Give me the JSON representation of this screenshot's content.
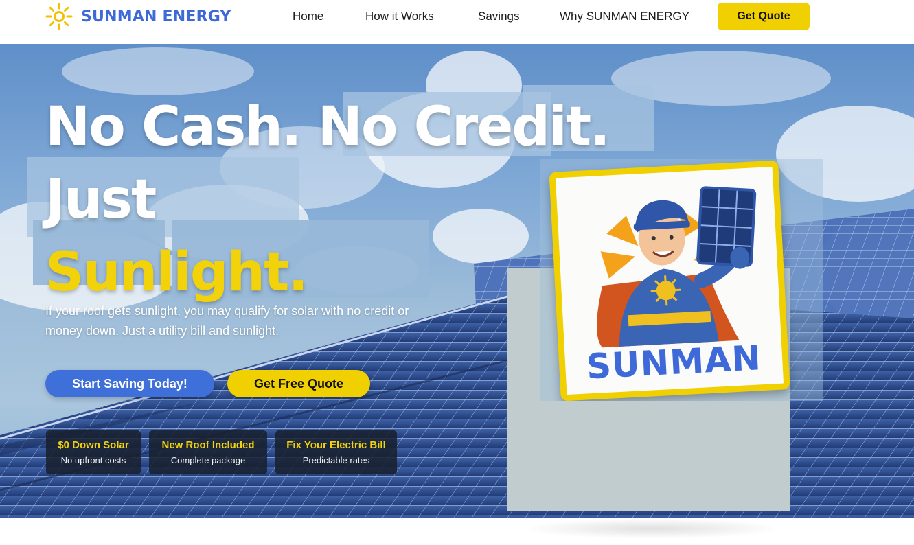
{
  "brand": {
    "name": "SUNMAN ENERGY",
    "logo_icon": "sun-icon",
    "primary_color": "#3d6ad8",
    "accent_color": "#f0d000"
  },
  "nav": {
    "items": [
      "Home",
      "How it Works",
      "Savings",
      "Why SUNMAN ENERGY"
    ],
    "cta_label": "Get Quote"
  },
  "hero": {
    "headline_white": "No Cash. No Credit. Just",
    "headline_yellow": "Sunlight.",
    "subtext": "If your roof gets sunlight, you may qualify for solar with no credit or money down. Just a utility bill and sunlight.",
    "primary_button": "Start Saving Today!",
    "secondary_button": "Get Free Quote",
    "badges": [
      {
        "title": "$0 Down Solar",
        "subtitle": "No upfront costs"
      },
      {
        "title": "New Roof Included",
        "subtitle": "Complete package"
      },
      {
        "title": "Fix Your Electric Bill",
        "subtitle": "Predictable rates"
      }
    ],
    "mascot_label": "SUNMAN"
  }
}
